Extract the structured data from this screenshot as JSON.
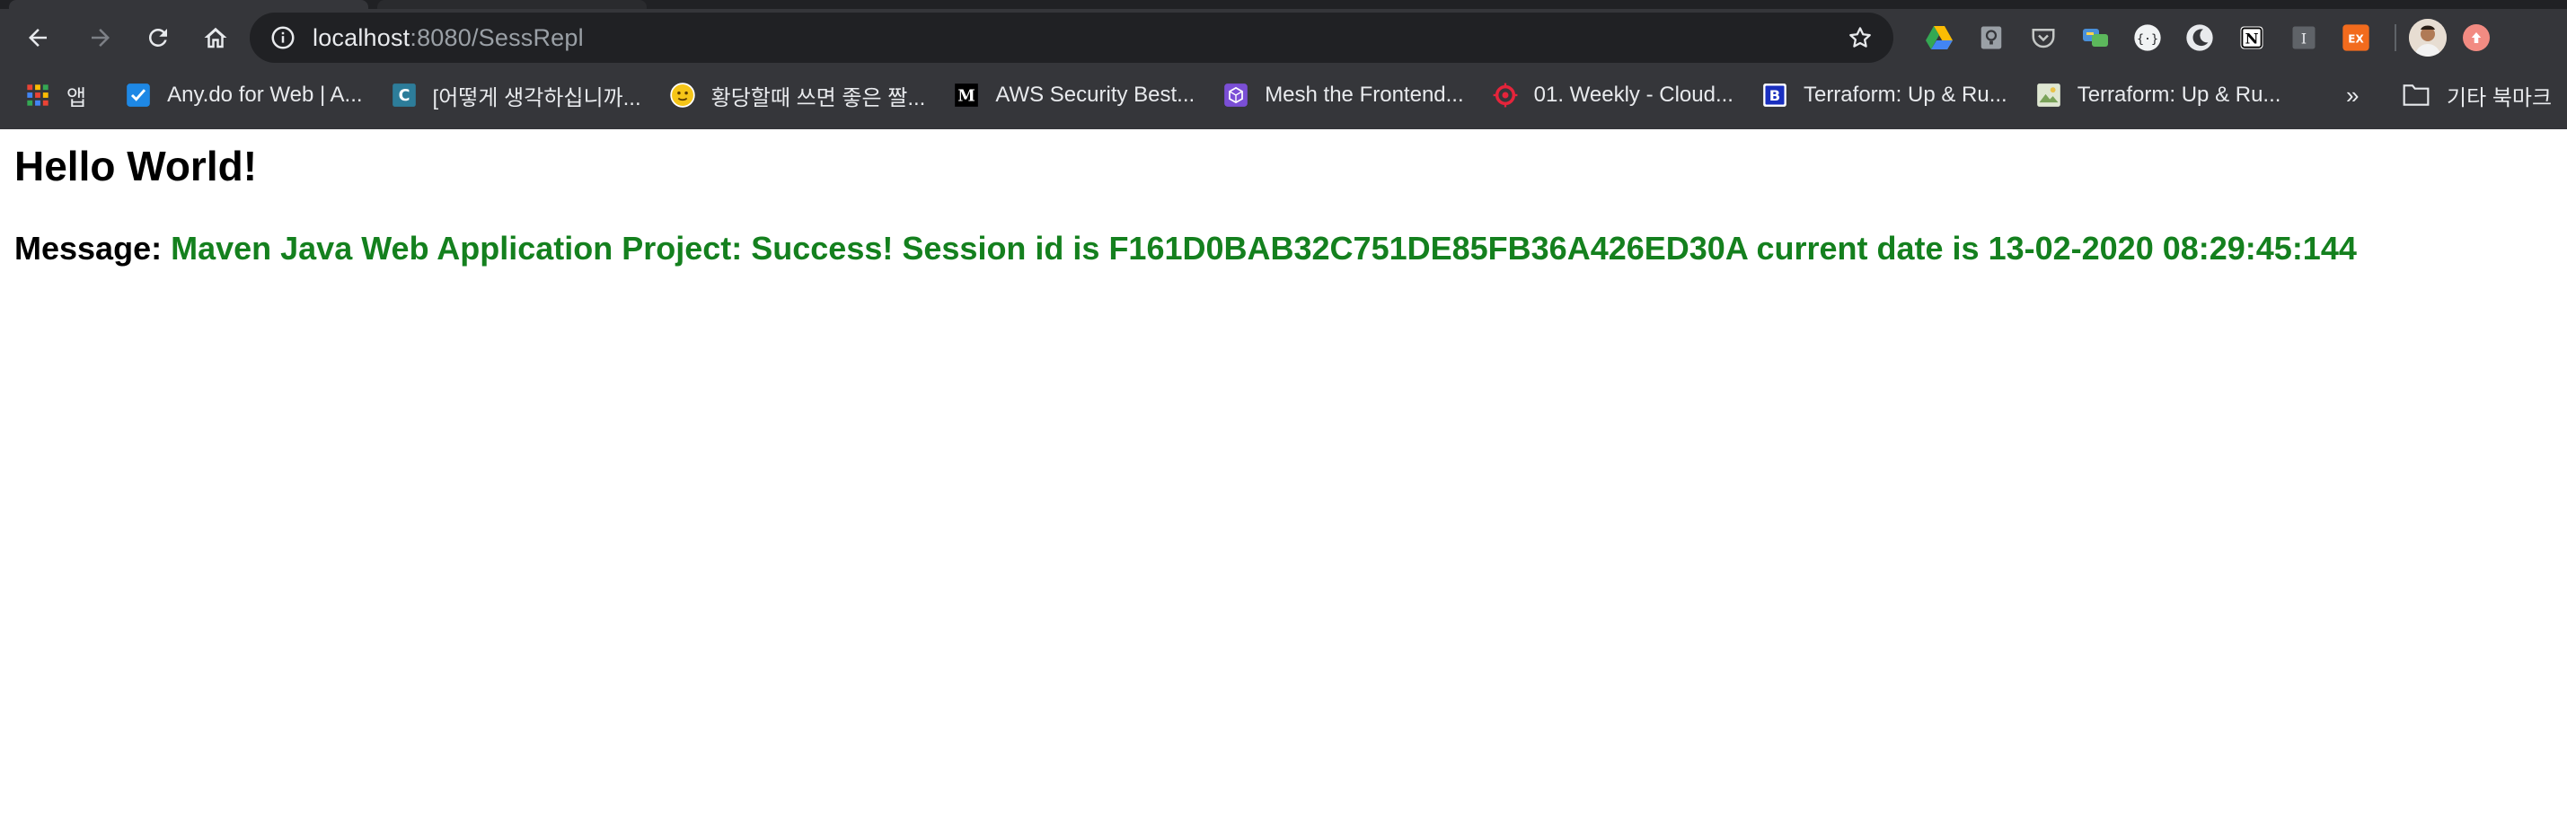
{
  "browser": {
    "url": {
      "host": "localhost",
      "path": ":8080/SessRepl"
    },
    "nav": {
      "back_icon": "arrow-left-icon",
      "forward_icon": "arrow-right-icon",
      "reload_icon": "reload-icon",
      "home_icon": "home-icon"
    },
    "extensions": [
      "google-drive-icon",
      "keep-icon",
      "pocket-icon",
      "translate-icon",
      "json-viewer-icon",
      "dark-reader-icon",
      "notion-icon",
      "instapaper-icon",
      "ex-icon"
    ],
    "ex_badge": "EX",
    "instapaper_letter": "I",
    "notion_letter": "N"
  },
  "bookmarks": {
    "apps_label": "앱",
    "items": [
      {
        "label": "Any.do for Web | A...",
        "icon": "anydo-icon",
        "color": "#1e88e5"
      },
      {
        "label": "[어떻게 생각하십니까...",
        "icon": "c-logo-icon",
        "color": "#2d7d9a",
        "letter": "C"
      },
      {
        "label": "황당할때 쓰면 좋은 짤...",
        "icon": "emoji-face-icon",
        "color": "#f5c518"
      },
      {
        "label": "AWS Security Best...",
        "icon": "medium-icon",
        "color": "#000000",
        "letter": "M"
      },
      {
        "label": "Mesh the Frontend...",
        "icon": "cube-icon",
        "color": "#7b4fd6"
      },
      {
        "label": "01. Weekly - Cloud...",
        "icon": "target-icon",
        "color": "#e5243b"
      },
      {
        "label": "Terraform: Up & Ru...",
        "icon": "b-logo-icon",
        "color": "#1a2fbf",
        "letter": "B"
      },
      {
        "label": "Terraform: Up & Ru...",
        "icon": "image-thumb-icon",
        "color": "#7aa35a"
      }
    ],
    "more": "»",
    "other_label": "기타 북마크"
  },
  "page": {
    "heading": "Hello World!",
    "message_label": "Message:",
    "message_value": "Maven Java Web Application Project: Success! Session id is F161D0BAB32C751DE85FB36A426ED30A current date is 13-02-2020 08:29:45:144",
    "message_color": "#14801e"
  }
}
